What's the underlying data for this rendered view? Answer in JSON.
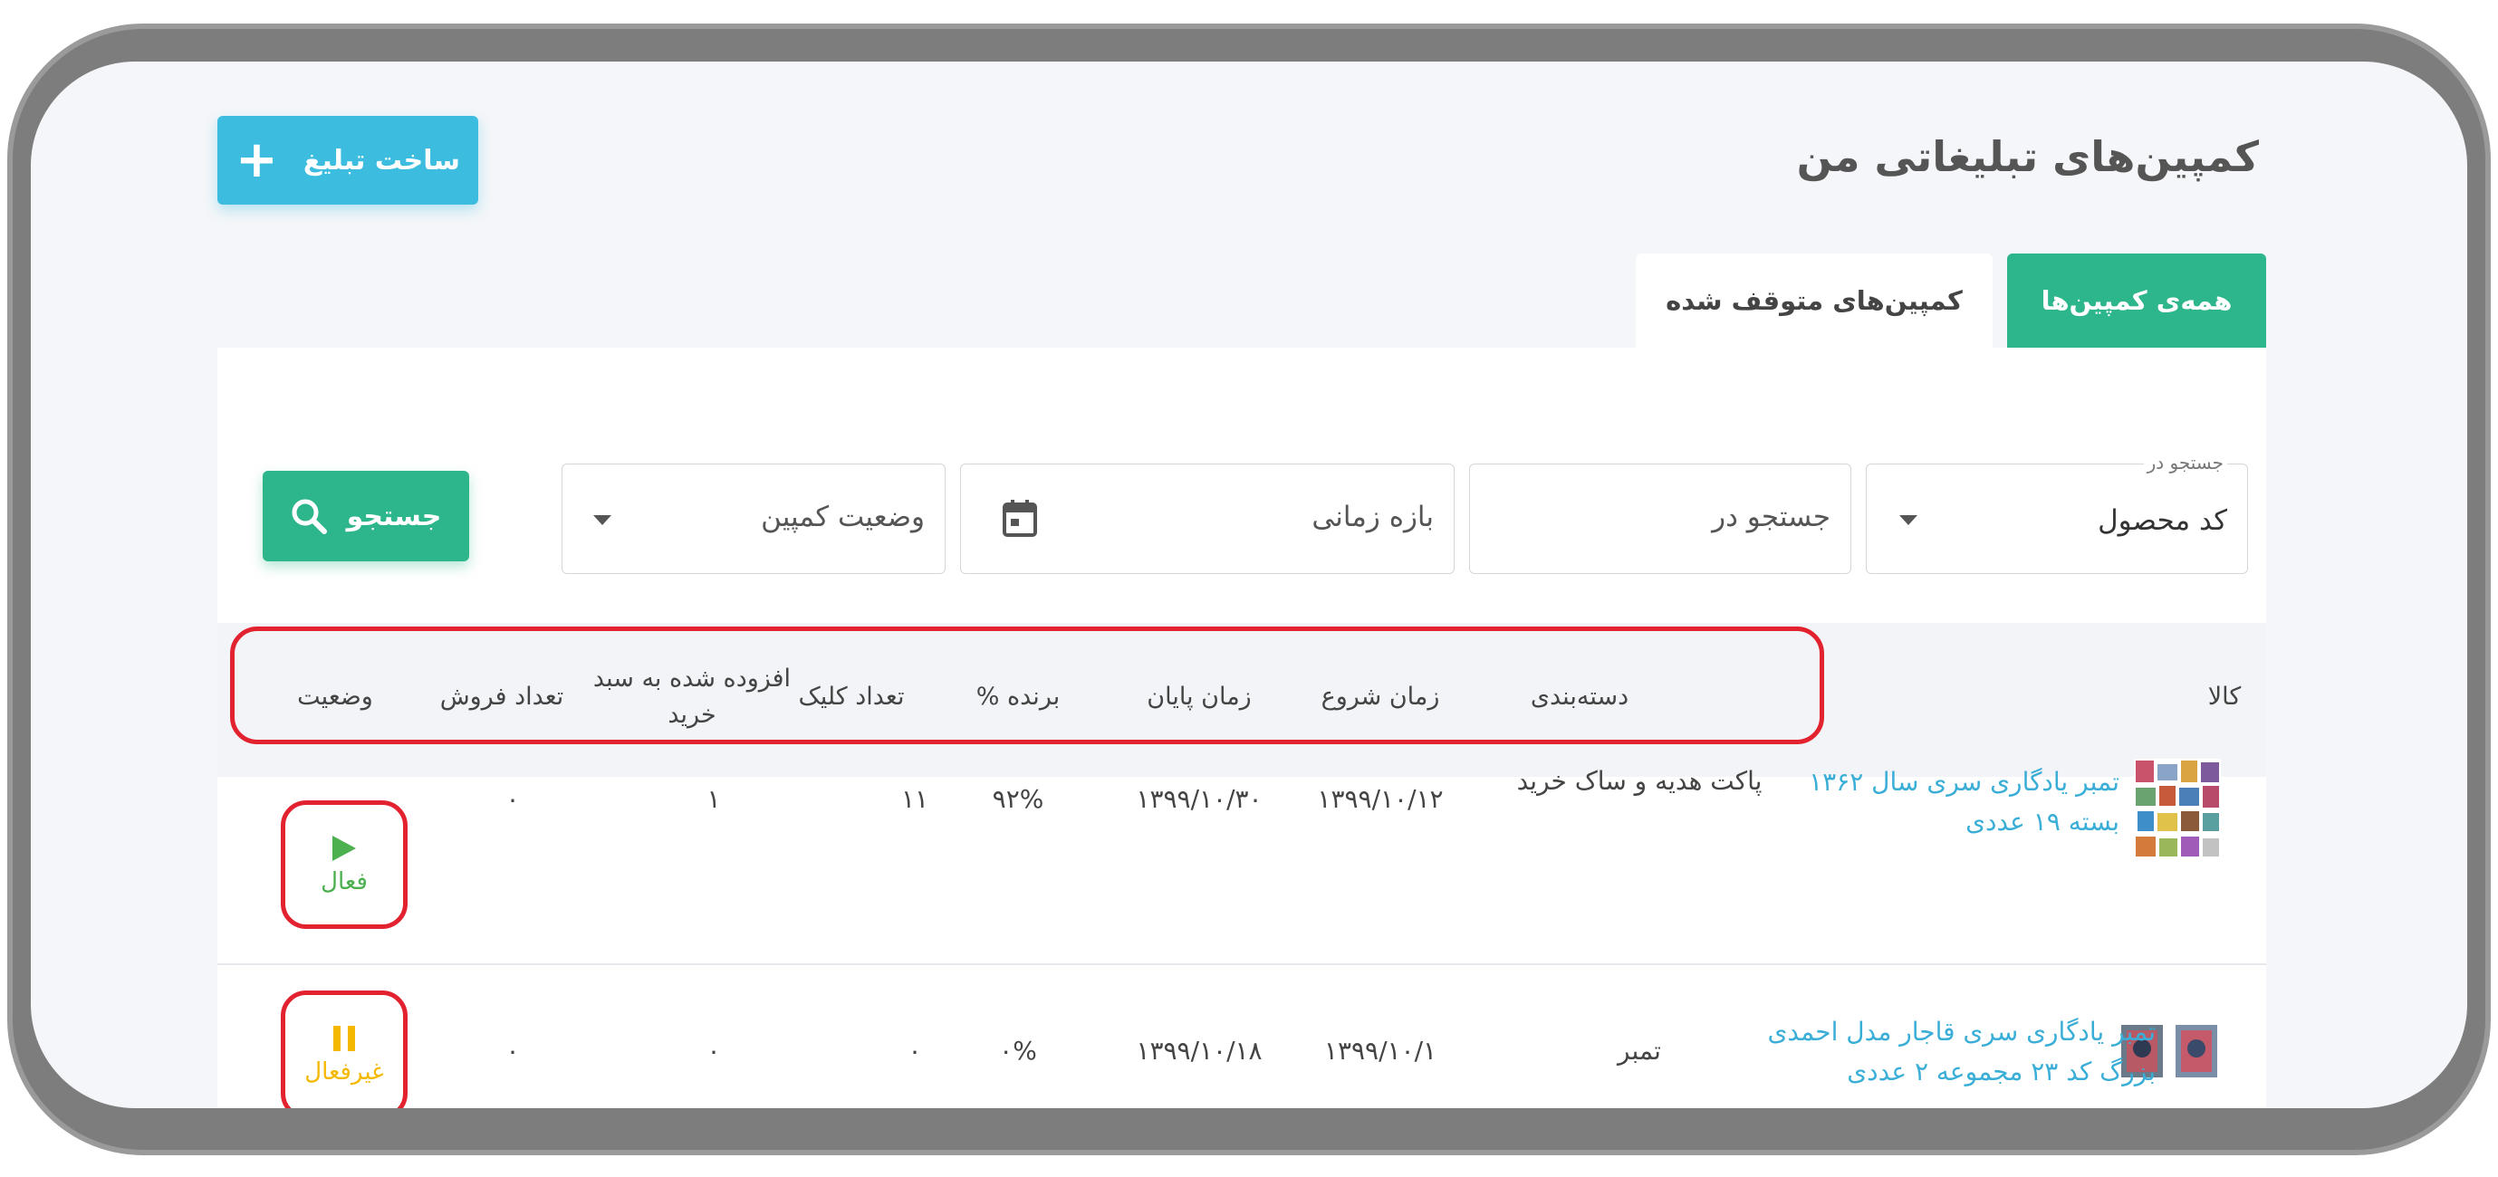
{
  "header": {
    "title": "کمپین‌های تبلیغاتی من",
    "create_button": "ساخت تبلیغ"
  },
  "tabs": [
    {
      "label": "همه‌ی کمپین‌ها",
      "active": true
    },
    {
      "label": "کمپین‌های متوقف شده",
      "active": false
    }
  ],
  "filters": {
    "search_in": {
      "label": "جستجو در",
      "value": "کد محصول"
    },
    "search_input": {
      "placeholder": "جستجو در"
    },
    "date_range": {
      "placeholder": "بازه زمانی"
    },
    "campaign_status": {
      "placeholder": "وضعیت کمپین"
    },
    "search_button": "جستجو"
  },
  "table": {
    "columns": [
      "کالا",
      "دسته‌بندی",
      "زمان شروع",
      "زمان پایان",
      "برنده %",
      "تعداد کلیک",
      "افزوده شده به سبد خرید",
      "تعداد فروش",
      "وضعیت"
    ],
    "rows": [
      {
        "product": "تمبر یادگاری سری سال ۱۳۶۲ بسته ۱۹ عددی",
        "category": "پاکت هدیه و ساک خرید",
        "start": "۱۳۹۹/۱۰/۱۲",
        "end": "۱۳۹۹/۱۰/۳۰",
        "win": "۹۲%",
        "clicks": "۱۱",
        "added_to_cart": "۱",
        "sales": "۰",
        "status": "فعال",
        "status_icon": "play-icon",
        "status_color": "#4caf50"
      },
      {
        "product": "تمبر یادگاری سری قاجار مدل احمدی بزرگ کد ۲۳ مجموعه ۲ عددی",
        "category": "تمبر",
        "start": "۱۳۹۹/۱۰/۱",
        "end": "۱۳۹۹/۱۰/۱۸",
        "win": "۰%",
        "clicks": "۰",
        "added_to_cart": "۰",
        "sales": "۰",
        "status": "غیرفعال",
        "status_icon": "pause-icon",
        "status_color": "#f5b800"
      }
    ]
  },
  "colors": {
    "accent_blue": "#3cbde0",
    "accent_green": "#2db68b",
    "highlight_red": "#e32230",
    "link": "#3aaed6"
  }
}
